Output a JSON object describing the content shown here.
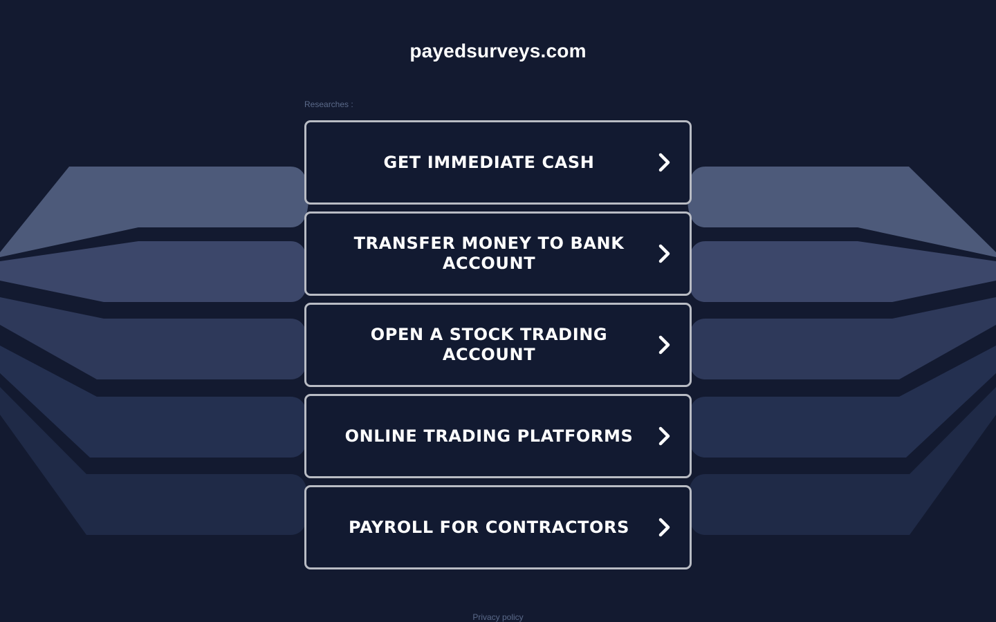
{
  "site": {
    "domain": "payedsurveys.com"
  },
  "searches": {
    "label": "Researches :"
  },
  "links": [
    {
      "label": "GET IMMEDIATE CASH"
    },
    {
      "label": "TRANSFER MONEY TO BANK ACCOUNT"
    },
    {
      "label": "OPEN A STOCK TRADING ACCOUNT"
    },
    {
      "label": "ONLINE TRADING PLATFORMS"
    },
    {
      "label": "PAYROLL FOR CONTRACTORS"
    }
  ],
  "footer": {
    "privacy_label": "Privacy policy"
  },
  "icons": {
    "link_arrow": "chevron-right-icon"
  },
  "colors": {
    "background": "#131a30",
    "box_border": "#b9bcc4",
    "muted_text": "#5b6a8a",
    "band_1": "#4d5a7a",
    "band_2": "#3a4668",
    "band_3": "#2d3858",
    "band_4": "#232d4b",
    "band_5": "#1e2844"
  }
}
